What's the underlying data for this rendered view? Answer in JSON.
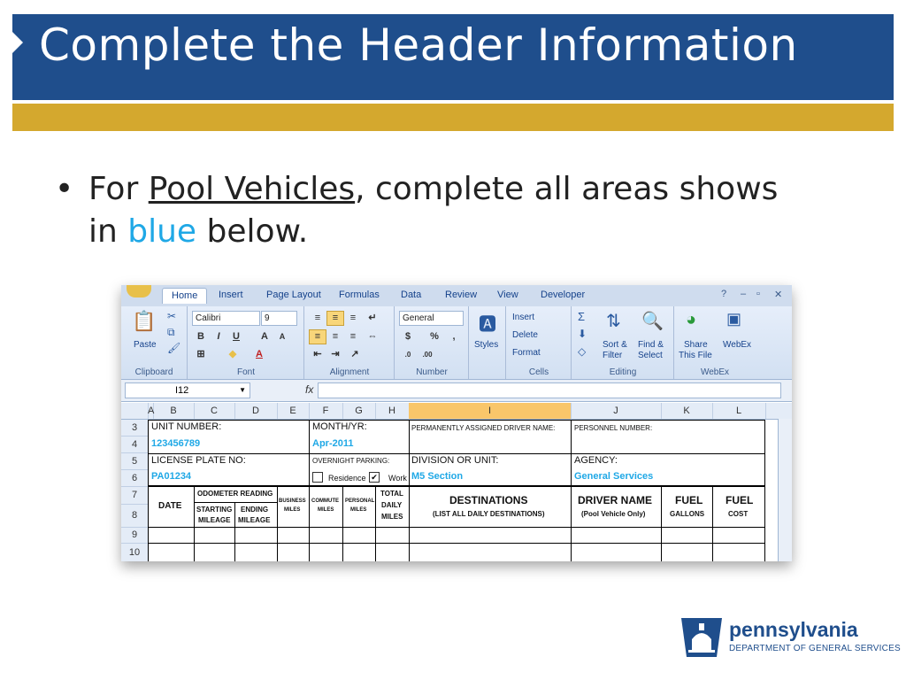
{
  "slide": {
    "title": "Complete the Header Information",
    "bullet_prefix": "For ",
    "bullet_underlined": "Pool Vehicles",
    "bullet_middle": ", complete all areas shows in ",
    "bullet_blue": "blue",
    "bullet_suffix": " below.",
    "colors": {
      "title_bg": "#1f4e8c",
      "accent_bar": "#d4a82e",
      "highlight": "#1fa8e6"
    }
  },
  "excel": {
    "tabs": [
      "Home",
      "Insert",
      "Page Layout",
      "Formulas",
      "Data",
      "Review",
      "View",
      "Developer"
    ],
    "ribbon": {
      "clipboard": {
        "paste": "Paste",
        "label": "Clipboard"
      },
      "font": {
        "name": "Calibri",
        "size": "9",
        "label": "Font"
      },
      "alignment": {
        "label": "Alignment"
      },
      "number": {
        "format": "General",
        "label": "Number",
        "currency": "$",
        "percent": "%"
      },
      "styles": {
        "label": "Styles"
      },
      "cells": {
        "insert": "Insert",
        "delete": "Delete",
        "format": "Format",
        "label": "Cells"
      },
      "editing": {
        "sort": "Sort &",
        "filter": "Filter",
        "find": "Find &",
        "select": "Select",
        "label": "Editing"
      },
      "webex": {
        "share": "Share",
        "this_file": "This File",
        "webex": "WebEx",
        "label": "WebEx"
      }
    },
    "name_box": "I12",
    "fx": "fx",
    "columns": [
      "A",
      "B",
      "C",
      "D",
      "E",
      "F",
      "G",
      "H",
      "I",
      "J",
      "K",
      "L"
    ],
    "rows": [
      "3",
      "4",
      "5",
      "6",
      "7",
      "8",
      "9",
      "10"
    ],
    "fields": {
      "unit_number_label": "UNIT NUMBER:",
      "unit_number_value": "123456789",
      "month_yr_label": "MONTH/YR:",
      "month_yr_value": "Apr-2011",
      "perm_driver_label": "PERMANENTLY ASSIGNED DRIVER NAME:",
      "personnel_number_label": "PERSONNEL NUMBER:",
      "license_plate_label": "LICENSE PLATE NO:",
      "license_plate_value": "PA01234",
      "overnight_parking_label": "OVERNIGHT PARKING:",
      "residence_label": "Residence",
      "work_label": "Work",
      "division_label": "DIVISION OR UNIT:",
      "division_value": "M5 Section",
      "agency_label": "AGENCY:",
      "agency_value": "General Services"
    },
    "table_headers": {
      "date": "DATE",
      "odometer": "ODOMETER READING",
      "starting": "STARTING",
      "starting2": "MILEAGE",
      "ending": "ENDING",
      "ending2": "MILEAGE",
      "business": "BUSINESS",
      "business2": "MILES",
      "commute": "COMMUTE",
      "commute2": "MILES",
      "personal": "PERSONAL",
      "personal2": "MILES",
      "total": "TOTAL",
      "total2": "DAILY",
      "total3": "MILES",
      "destinations": "DESTINATIONS",
      "destinations_sub": "(LIST ALL DAILY DESTINATIONS)",
      "driver_name": "DRIVER NAME",
      "driver_name_sub": "(Pool Vehicle Only)",
      "fuel_gallons": "FUEL",
      "fuel_gallons_sub": "GALLONS",
      "fuel_cost": "FUEL",
      "fuel_cost_sub": "COST"
    }
  },
  "logo": {
    "name": "pennsylvania",
    "department": "DEPARTMENT OF GENERAL SERVICES"
  }
}
